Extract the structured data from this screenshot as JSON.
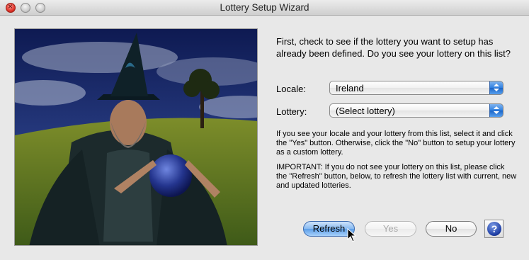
{
  "window": {
    "title": "Lottery Setup Wizard"
  },
  "intro_text": "First, check to see if the lottery you want to setup has already been defined. Do you see your lottery on this list?",
  "locale": {
    "label": "Locale:",
    "selected": "Ireland"
  },
  "lottery": {
    "label": "Lottery:",
    "selected": "(Select lottery)"
  },
  "help_paragraph_1": "If you see your locale and your lottery from this list, select it and click the \"Yes\" button. Otherwise, click the \"No\" button to setup your lottery as a custom lottery.",
  "help_paragraph_2": "IMPORTANT: If you do not see your lottery on this list, please click the \"Refresh\" button, below, to refresh the lottery list with current, new and updated lotteries.",
  "buttons": {
    "refresh": "Refresh",
    "yes": "Yes",
    "no": "No",
    "help_glyph": "?"
  },
  "icons": {
    "help": "help-icon",
    "cursor": "pointer-cursor-icon",
    "popup_arrows": "up-down-arrows-icon"
  },
  "colors": {
    "accent": "#5c9ee8",
    "window_bg": "#e8e8e8"
  }
}
